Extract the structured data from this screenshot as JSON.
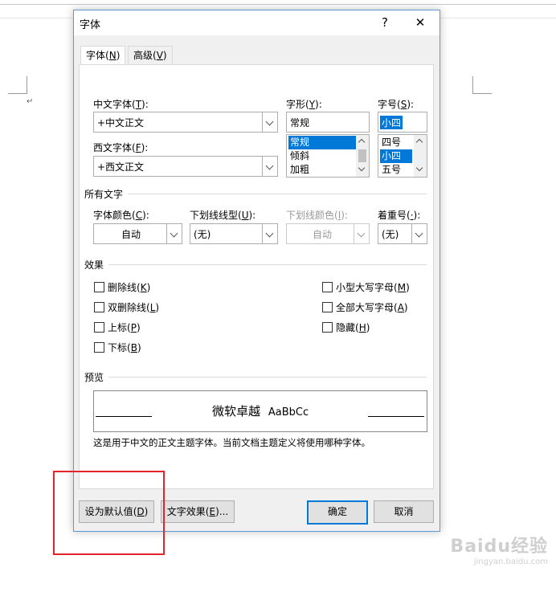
{
  "dialog": {
    "title": "字体",
    "help_label": "?",
    "close_label": "✕",
    "tabs": [
      {
        "label": "字体",
        "key": "N"
      },
      {
        "label": "高级",
        "key": "V"
      }
    ]
  },
  "font": {
    "chinese_font_label": "中文字体",
    "chinese_font_key": "T",
    "chinese_font_value": "+中文正文",
    "western_font_label": "西文字体",
    "western_font_key": "F",
    "western_font_value": "+西文正文",
    "style_label": "字形",
    "style_key": "Y",
    "style_value": "常规",
    "style_options": [
      "常规",
      "倾斜",
      "加粗"
    ],
    "size_label": "字号",
    "size_key": "S",
    "size_value": "小四",
    "size_options": [
      "四号",
      "小四",
      "五号"
    ]
  },
  "all_text": {
    "section_label": "所有文字",
    "font_color_label": "字体颜色",
    "font_color_key": "C",
    "font_color_value": "自动",
    "underline_style_label": "下划线线型",
    "underline_style_key": "U",
    "underline_style_value": "(无)",
    "underline_color_label": "下划线颜色",
    "underline_color_key": "I",
    "underline_color_value": "自动",
    "emphasis_label": "着重号",
    "emphasis_key": "·",
    "emphasis_value": "(无)"
  },
  "effects": {
    "section_label": "效果",
    "left": [
      {
        "label": "删除线",
        "key": "K"
      },
      {
        "label": "双删除线",
        "key": "L"
      },
      {
        "label": "上标",
        "key": "P"
      },
      {
        "label": "下标",
        "key": "B"
      }
    ],
    "right": [
      {
        "label": "小型大写字母",
        "key": "M"
      },
      {
        "label": "全部大写字母",
        "key": "A"
      },
      {
        "label": "隐藏",
        "key": "H"
      }
    ]
  },
  "preview": {
    "section_label": "预览",
    "sample_cn": "微软卓越",
    "sample_en": "AaBbCc",
    "description": "这是用于中文的正文主题字体。当前文档主题定义将使用哪种字体。"
  },
  "buttons": {
    "set_default": "设为默认值",
    "set_default_key": "D",
    "text_effects": "文字效果",
    "text_effects_key": "E",
    "ok": "确定",
    "cancel": "取消"
  },
  "watermark": {
    "brand": "Baidu经验",
    "url": "jingyan.baidu.com"
  },
  "colors": {
    "accent": "#0078d7",
    "highlight_box": "#e3242b",
    "dialog_border": "#5a9bd5"
  }
}
